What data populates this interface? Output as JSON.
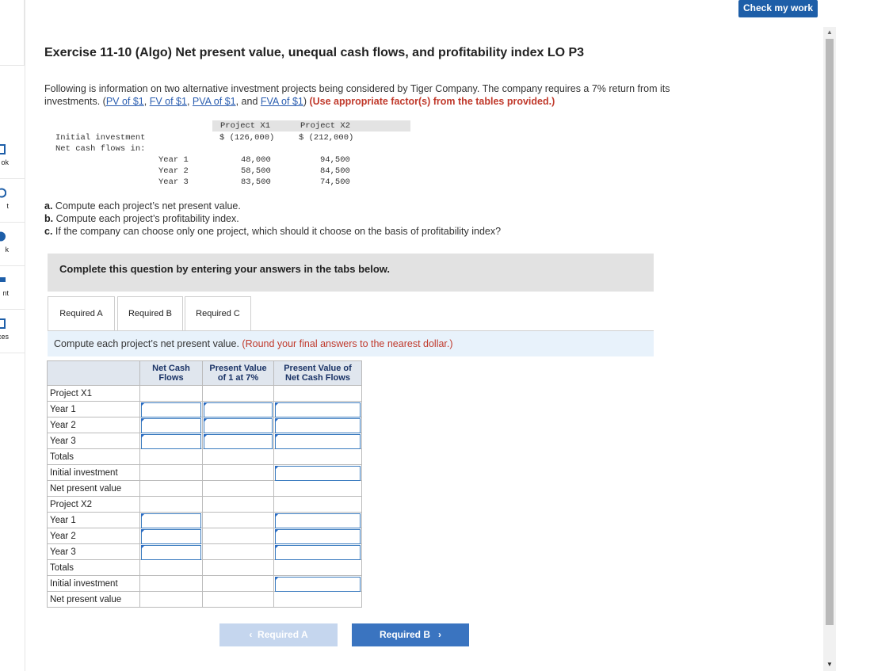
{
  "header": {
    "check_button": "Check my work"
  },
  "sidebar": {
    "items": [
      {
        "label": "ok",
        "icon": "book-icon"
      },
      {
        "label": "t",
        "icon": "print-icon"
      },
      {
        "label": "k",
        "icon": "bookmark-icon"
      },
      {
        "label": "nt",
        "icon": "print-icon"
      },
      {
        "label": "nces",
        "icon": "references-icon"
      }
    ]
  },
  "title": "Exercise 11-10 (Algo) Net present value, unequal cash flows, and profitability index LO P3",
  "intro": {
    "text1": "Following is information on two alternative investment projects being considered by Tiger Company. The company requires a 7% return from its investments. (",
    "links": [
      "PV of $1",
      "FV of $1",
      "PVA of $1",
      "FVA of $1"
    ],
    "sep1": ", ",
    "sep2": ", ",
    "sep3": ", and ",
    "text2": ") ",
    "instruction": "(Use appropriate factor(s) from the tables provided.)"
  },
  "given": {
    "col_x1": "Project X1",
    "col_x2": "Project X2",
    "initial_label": "Initial investment",
    "flows_label": "Net cash flows in:",
    "initial_x1": "$ (126,000)",
    "initial_x2": "$ (212,000)",
    "years": [
      {
        "label": "Year 1",
        "x1": "48,000",
        "x2": "94,500"
      },
      {
        "label": "Year 2",
        "x1": "58,500",
        "x2": "84,500"
      },
      {
        "label": "Year 3",
        "x1": "83,500",
        "x2": "74,500"
      }
    ]
  },
  "questions": [
    {
      "letter": "a.",
      "text": " Compute each project’s net present value."
    },
    {
      "letter": "b.",
      "text": " Compute each project’s profitability index."
    },
    {
      "letter": "c.",
      "text": " If the company can choose only one project, which should it choose on the basis of profitability index?"
    }
  ],
  "banner": "Complete this question by entering your answers in the tabs below.",
  "tabs": [
    "Required A",
    "Required B",
    "Required C"
  ],
  "instruction": {
    "text": "Compute each project’s net present value. ",
    "note": "(Round your final answers to the nearest dollar.)"
  },
  "table": {
    "headers": [
      "Net Cash Flows",
      "Present Value of 1 at 7%",
      "Present Value of Net Cash Flows"
    ],
    "rows": [
      "Project X1",
      "Year 1",
      "Year 2",
      "Year 3",
      "Totals",
      "Initial investment",
      "Net present value",
      "Project X2",
      "Year 1",
      "Year 2",
      "Year 3",
      "Totals",
      "Initial investment",
      "Net present value"
    ]
  },
  "nav": {
    "prev": "Required A",
    "next": "Required B"
  }
}
